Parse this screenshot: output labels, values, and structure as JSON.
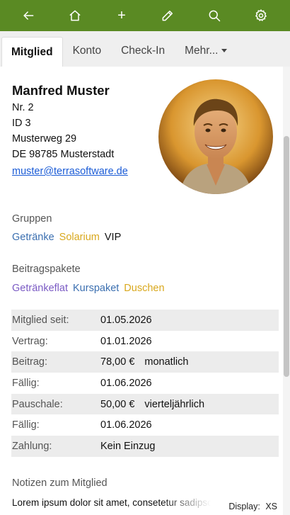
{
  "toolbar": {
    "icons": [
      "back-arrow-icon",
      "home-icon",
      "plus-icon",
      "edit-pencil-icon",
      "search-icon",
      "settings-gear-icon"
    ],
    "add_label": "+"
  },
  "tabs": [
    {
      "label": "Mitglied",
      "active": true
    },
    {
      "label": "Konto",
      "active": false
    },
    {
      "label": "Check-In",
      "active": false
    },
    {
      "label": "Mehr...",
      "active": false
    }
  ],
  "member": {
    "name": "Manfred Muster",
    "number": "Nr. 2",
    "id": "ID 3",
    "street": "Musterweg 29",
    "city": "DE 98785 Musterstadt",
    "email": "muster@terrasoftware.de"
  },
  "groups": {
    "title": "Gruppen",
    "items": [
      {
        "label": "Getränke",
        "color": "#3b6fb0"
      },
      {
        "label": "Solarium",
        "color": "#d9a81d"
      },
      {
        "label": "VIP",
        "color": "#111111"
      }
    ]
  },
  "packages": {
    "title": "Beitragspakete",
    "items": [
      {
        "label": "Getränkeflat",
        "color": "#7b5bc4"
      },
      {
        "label": "Kurspaket",
        "color": "#3b6fb0"
      },
      {
        "label": "Duschen",
        "color": "#d9a81d"
      }
    ]
  },
  "details": [
    {
      "label": "Mitglied seit:",
      "value": "01.05.2026",
      "extra": ""
    },
    {
      "label": "Vertrag:",
      "value": "01.01.2026",
      "extra": ""
    },
    {
      "label": "Beitrag:",
      "value": "78,00 €",
      "extra": "monatlich"
    },
    {
      "label": "Fällig:",
      "value": "01.06.2026",
      "extra": ""
    },
    {
      "label": "Pauschale:",
      "value": "50,00 €",
      "extra": "vierteljährlich"
    },
    {
      "label": "Fällig:",
      "value": "01.06.2026",
      "extra": ""
    },
    {
      "label": "Zahlung:",
      "value": "Kein Einzug",
      "extra": ""
    }
  ],
  "notes": {
    "title": "Notizen zum Mitglied",
    "text": "Lorem ipsum dolor sit amet, consetetur sadipscing elitr, sed"
  },
  "display": {
    "label": "Display:",
    "value": "XS"
  },
  "colors": {
    "toolbar": "#5a8a23",
    "link": "#1a5bd6"
  }
}
